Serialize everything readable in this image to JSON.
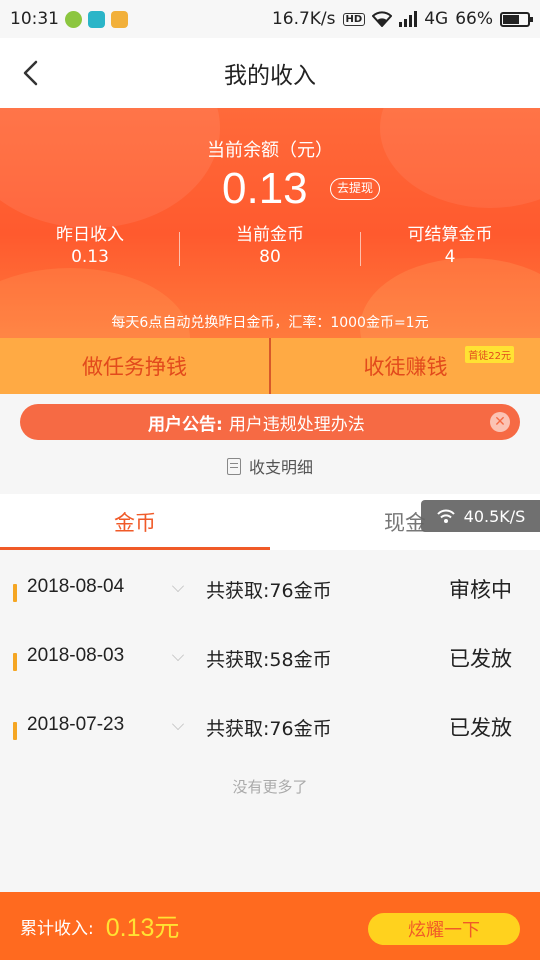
{
  "status_bar": {
    "time": "10:31",
    "net_speed": "16.7K/s",
    "hd": "HD",
    "network": "4G",
    "battery": "66%",
    "battery_level": 0.66
  },
  "header": {
    "title": "我的收入"
  },
  "balance": {
    "label": "当前余额（元）",
    "value": "0.13",
    "withdraw_label": "去提现"
  },
  "stats": [
    {
      "label": "昨日收入",
      "value": "0.13"
    },
    {
      "label": "当前金币",
      "value": "80"
    },
    {
      "label": "可结算金币",
      "value": "4"
    }
  ],
  "exchange_note": "每天6点自动兑换昨日金币，汇率：1000金币=1元",
  "actions": {
    "task_label": "做任务挣钱",
    "invite_label": "收徒赚钱",
    "invite_badge": "首徒22元"
  },
  "notice": {
    "label": "用户公告:",
    "text": "用户违规处理办法"
  },
  "detail_link": "收支明细",
  "tabs": [
    {
      "label": "金币",
      "active": true
    },
    {
      "label": "现金",
      "active": false
    }
  ],
  "speed_toast": "40.5K/S",
  "records": [
    {
      "date": "2018-08-04",
      "amount": "共获取:76金币",
      "status": "审核中"
    },
    {
      "date": "2018-08-03",
      "amount": "共获取:58金币",
      "status": "已发放"
    },
    {
      "date": "2018-07-23",
      "amount": "共获取:76金币",
      "status": "已发放"
    }
  ],
  "no_more": "没有更多了",
  "footer": {
    "label": "累计收入:",
    "value": "0.13元",
    "button": "炫耀一下"
  },
  "colors": {
    "primary": "#ff5a2e",
    "action_bar": "#ffaa44",
    "accent_text": "#f05a28",
    "yellow": "#ffd21e"
  },
  "icons": [
    "back-arrow-icon",
    "wifi-icon",
    "signal-icon",
    "battery-icon",
    "close-icon",
    "document-icon",
    "chevron-down-icon"
  ]
}
